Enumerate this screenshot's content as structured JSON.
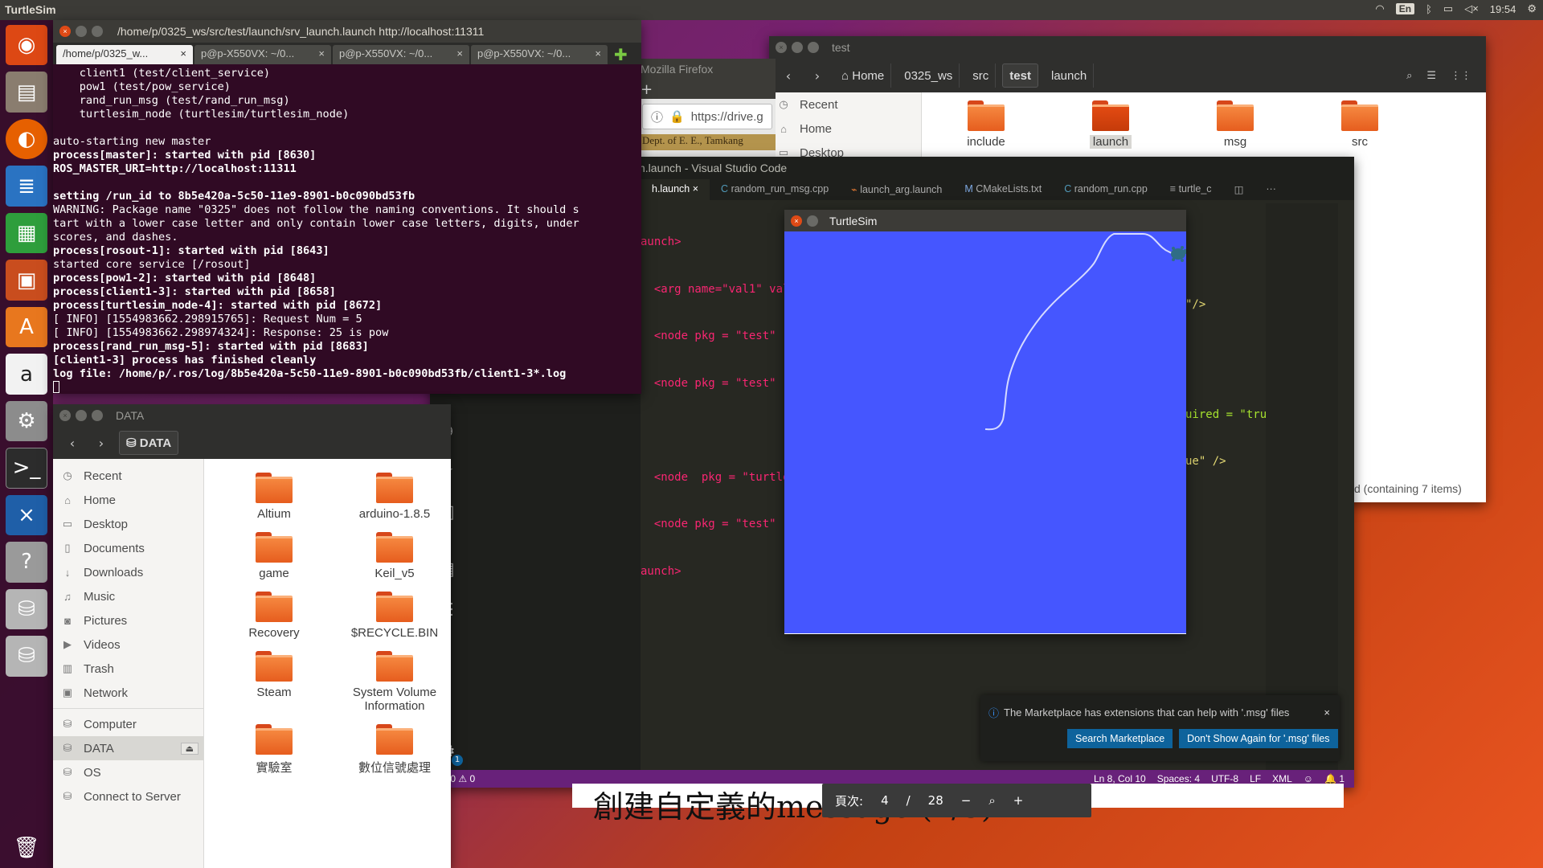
{
  "topbar": {
    "app": "TurtleSim",
    "lang": "En",
    "time": "19:54"
  },
  "launcher": {
    "items": [
      "ubuntu-icon",
      "files-icon",
      "firefox-icon",
      "writer-icon",
      "calc-icon",
      "impress-icon",
      "software-icon",
      "amazon-icon",
      "settings-icon",
      "terminal-icon",
      "vscode-icon",
      "help-icon",
      "drive-icon",
      "drive2-icon",
      "trash-icon"
    ]
  },
  "terminal": {
    "title": "/home/p/0325_ws/src/test/launch/srv_launch.launch http://localhost:11311",
    "tabs": [
      "/home/p/0325_w...",
      "p@p-X550VX: ~/0...",
      "p@p-X550VX: ~/0...",
      "p@p-X550VX: ~/0..."
    ],
    "lines": [
      {
        "t": "    client1 (test/client_service)",
        "b": false
      },
      {
        "t": "    pow1 (test/pow_service)",
        "b": false
      },
      {
        "t": "    rand_run_msg (test/rand_run_msg)",
        "b": false
      },
      {
        "t": "    turtlesim_node (turtlesim/turtlesim_node)",
        "b": false
      },
      {
        "t": "",
        "b": false
      },
      {
        "t": "auto-starting new master",
        "b": false
      },
      {
        "t": "process[master]: started with pid [8630]",
        "b": true
      },
      {
        "t": "ROS_MASTER_URI=http://localhost:11311",
        "b": true
      },
      {
        "t": "",
        "b": false
      },
      {
        "t": "setting /run_id to 8b5e420a-5c50-11e9-8901-b0c090bd53fb",
        "b": true
      },
      {
        "t": "WARNING: Package name \"0325\" does not follow the naming conventions. It should s",
        "b": false
      },
      {
        "t": "tart with a lower case letter and only contain lower case letters, digits, under",
        "b": false
      },
      {
        "t": "scores, and dashes.",
        "b": false
      },
      {
        "t": "process[rosout-1]: started with pid [8643]",
        "b": true
      },
      {
        "t": "started core service [/rosout]",
        "b": false
      },
      {
        "t": "process[pow1-2]: started with pid [8648]",
        "b": true
      },
      {
        "t": "process[client1-3]: started with pid [8658]",
        "b": true
      },
      {
        "t": "process[turtlesim_node-4]: started with pid [8672]",
        "b": true
      },
      {
        "t": "[ INFO] [1554983662.298915765]: Request Num = 5",
        "b": false
      },
      {
        "t": "[ INFO] [1554983662.298974324]: Response: 25 is pow",
        "b": false
      },
      {
        "t": "process[rand_run_msg-5]: started with pid [8683]",
        "b": true
      },
      {
        "t": "[client1-3] process has finished cleanly",
        "b": true
      },
      {
        "t": "log file: /home/p/.ros/log/8b5e420a-5c50-11e9-8901-b0c090bd53fb/client1-3*.log",
        "b": true
      }
    ]
  },
  "data_win": {
    "title": "DATA",
    "crumb": "DATA",
    "sidebar": [
      "Recent",
      "Home",
      "Desktop",
      "Documents",
      "Downloads",
      "Music",
      "Pictures",
      "Videos",
      "Trash",
      "Network",
      "Computer",
      "DATA",
      "OS",
      "Connect to Server"
    ],
    "folders": [
      "Altium",
      "arduino-1.8.5",
      "game",
      "Keil_v5",
      "Recovery",
      "$RECYCLE.BIN",
      "Steam",
      "System Volume Information",
      "實驗室",
      "數位信號處理"
    ]
  },
  "test_win": {
    "title": "test",
    "crumbs": [
      "Home",
      "0325_ws",
      "src",
      "test",
      "launch"
    ],
    "sidebar": [
      "Recent",
      "Home",
      "Desktop"
    ],
    "folders": [
      "include",
      "launch",
      "msg",
      "src"
    ],
    "status": "d (containing 7 items)"
  },
  "firefox": {
    "title": "Mozilla Firefox",
    "url": "https://drive.g",
    "page_snip": "Dept. of E. E., Tamkang"
  },
  "vscode": {
    "title": "h.launch - Visual Studio Code",
    "tabs": [
      "h.launch",
      "random_run_msg.cpp",
      "launch_arg.launch",
      "CMakeLists.txt",
      "random_run.cpp",
      "turtle_c"
    ],
    "code": [
      "aunch>",
      "  <arg name=\"val1\" val",
      "  <node pkg = \"test\"",
      "  <node pkg = \"test\"",
      "",
      "  <node  pkg = \"turtle",
      "  <node pkg = \"test\"",
      "aunch>"
    ],
    "right_frag": [
      "\"/>",
      "uired = \"tru",
      "ue\" />"
    ],
    "status": {
      "errors": "0",
      "warnings": "0",
      "pos": "Ln 8, Col 10",
      "spaces": "Spaces: 4",
      "enc": "UTF-8",
      "eol": "LF",
      "lang": "XML",
      "bell": "1"
    },
    "gear_badge": "1"
  },
  "notification": {
    "text": "The Marketplace has extensions that can help with '.msg' files",
    "btn1": "Search Marketplace",
    "btn2": "Don't Show Again for '.msg' files"
  },
  "turtlesim": {
    "title": "TurtleSim",
    "bg": "#4556ff",
    "path_color": "#d6dbff"
  },
  "pdf": {
    "page_label": "頁次:",
    "page": "4",
    "sep": "/",
    "total": "28",
    "slide_text": "創建自定義的message (1/3)"
  }
}
